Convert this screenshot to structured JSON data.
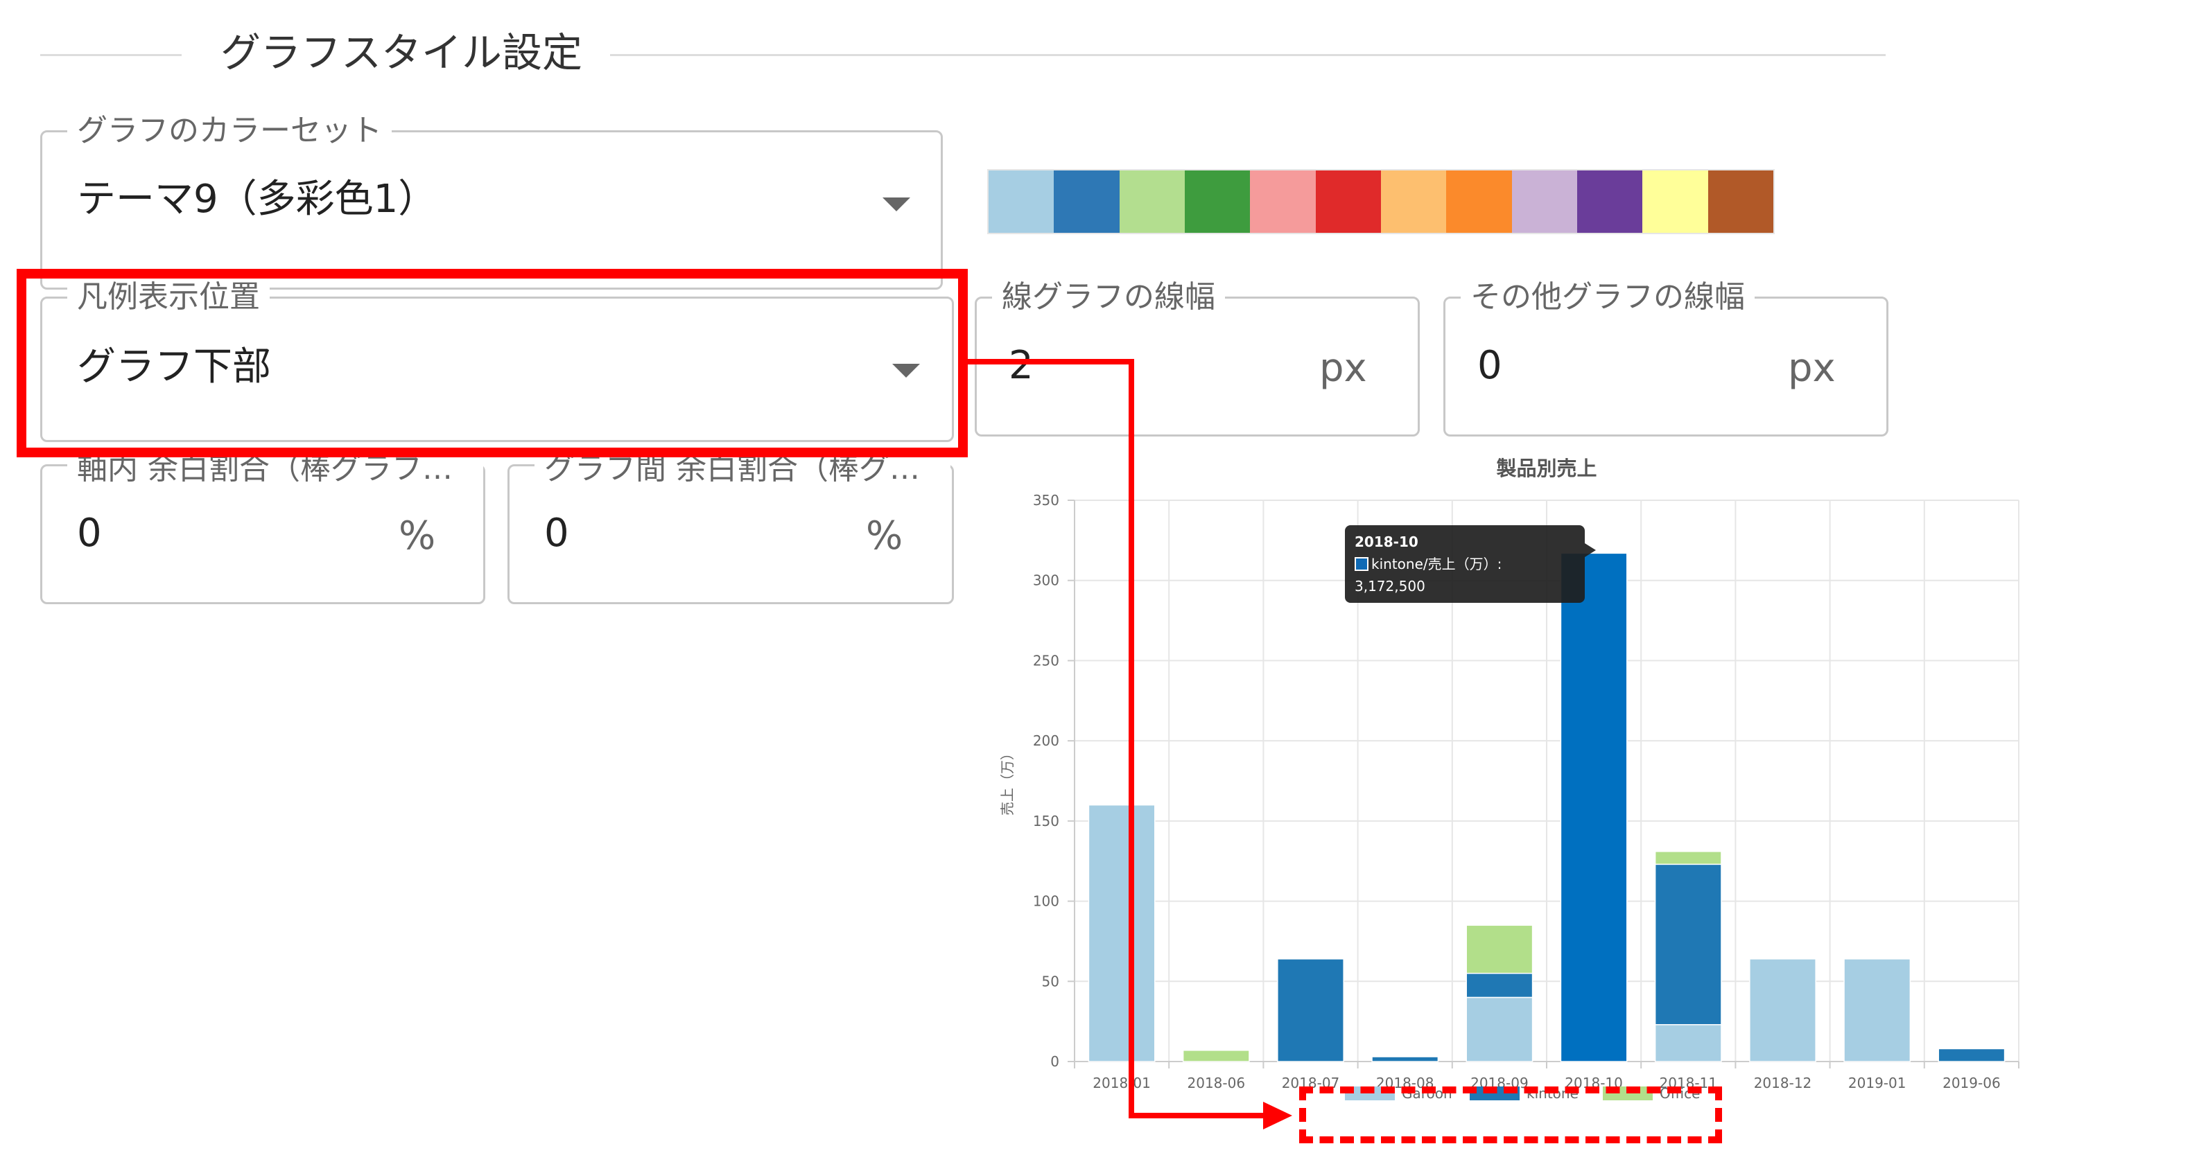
{
  "section": {
    "title": "グラフスタイル設定"
  },
  "color_set": {
    "label": "グラフのカラーセット",
    "value": "テーマ9（多彩色1）",
    "swatches": [
      "#a6cee3",
      "#2e78b5",
      "#b3de8f",
      "#3e9c3e",
      "#f59b9b",
      "#e02a2a",
      "#fdbf6f",
      "#fb8a2b",
      "#cab2d6",
      "#6a3d9a",
      "#ffff99",
      "#b15928"
    ]
  },
  "legend_position": {
    "label": "凡例表示位置",
    "value": "グラフ下部"
  },
  "line_width": {
    "label": "線グラフの線幅",
    "value": "2",
    "unit": "px"
  },
  "other_width": {
    "label": "その他グラフの線幅",
    "value": "0",
    "unit": "px"
  },
  "axis_gap": {
    "label": "軸内 余白割合（棒グラフ…",
    "value": "0",
    "unit": "%"
  },
  "graph_gap": {
    "label": "グラフ間 余白割合（棒グ…",
    "value": "0",
    "unit": "%"
  },
  "tooltip": {
    "title": "2018-10",
    "text": "kintone/売上（万）: 3,172,500",
    "color": "#0f6ab5"
  },
  "colors": {
    "highlight": "#ff0000"
  },
  "chart_data": {
    "type": "bar",
    "stacked": true,
    "title": "製品別売上",
    "ylabel": "売上（万）",
    "xlabel": "",
    "categories": [
      "2018-01",
      "2018-06",
      "2018-07",
      "2018-08",
      "2018-09",
      "2018-10",
      "2018-11",
      "2018-12",
      "2019-01",
      "2019-06"
    ],
    "series": [
      {
        "name": "Garoon",
        "color": "#a6cee3",
        "values": [
          160,
          0,
          0,
          0,
          40,
          0,
          23,
          64,
          64,
          0
        ]
      },
      {
        "name": "kintone",
        "color": "#1f78b4",
        "values": [
          0,
          0,
          64,
          3,
          15,
          317,
          100,
          0,
          0,
          8
        ]
      },
      {
        "name": "Office",
        "color": "#b2df8a",
        "values": [
          0,
          7,
          0,
          0,
          30,
          0,
          8,
          0,
          0,
          0
        ]
      }
    ],
    "highlight_index": 5,
    "highlight_color": "#0070c0",
    "ylim": [
      0,
      350
    ],
    "yticks": [
      0,
      50,
      100,
      150,
      200,
      250,
      300,
      350
    ],
    "grid": true,
    "legend": "bottom"
  }
}
